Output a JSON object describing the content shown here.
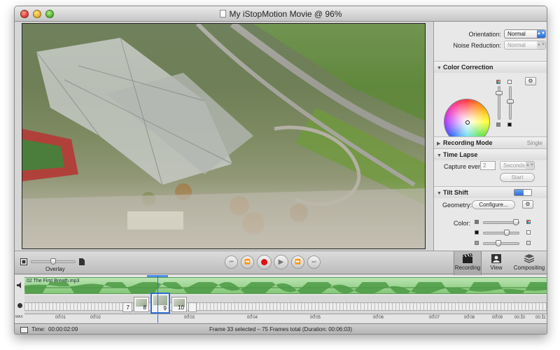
{
  "window": {
    "title": "My iStopMotion Movie @ 96%"
  },
  "inspector": {
    "orientation": {
      "label": "Orientation:",
      "value": "Normal"
    },
    "noise_reduction": {
      "label": "Noise Reduction:",
      "value": "Normal"
    },
    "color_correction": {
      "title": "Color Correction"
    },
    "recording_mode": {
      "title": "Recording Mode",
      "value": "Single"
    },
    "time_lapse": {
      "title": "Time Lapse",
      "capture_label": "Capture every:",
      "capture_value": "2",
      "unit": "Seconds",
      "start_label": "Start"
    },
    "tilt_shift": {
      "title": "Tilt Shift",
      "geometry_label": "Geometry:",
      "configure_label": "Configure...",
      "color_label": "Color:"
    }
  },
  "controls": {
    "overlay_label": "Overlay",
    "buttons": [
      "Recording",
      "View",
      "Compositing"
    ]
  },
  "timeline": {
    "audio_clip": "02 The First Breath.mp3",
    "frames": [
      "7",
      "8",
      "9",
      "10"
    ],
    "current_frame": "9",
    "ruler": [
      "00:01",
      "00:02",
      "00:03",
      "00:04",
      "00:05",
      "00:06",
      "00:07",
      "00:08",
      "00:09",
      "00:10",
      "00:11"
    ],
    "zoom_label": "MAX"
  },
  "status": {
    "time_label": "Time:",
    "time_value": "00:00:02:09",
    "frame_info": "Frame 33 selected – 75 Frames total (Duration: 00:06:03)"
  },
  "colors": {
    "accent": "#2f6fd3",
    "record": "#e01010",
    "audio_track": "#86c77a"
  }
}
